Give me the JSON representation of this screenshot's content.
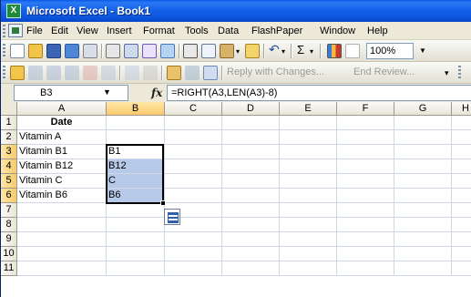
{
  "window": {
    "title": "Microsoft Excel - Book1",
    "app_icon_glyph": "X"
  },
  "menu": [
    "File",
    "Edit",
    "View",
    "Insert",
    "Format",
    "Tools",
    "Data",
    "FlashPaper",
    "Window",
    "Help"
  ],
  "toolbar": {
    "zoom": "100%",
    "sum_glyph": "Σ",
    "undo_glyph": "↶",
    "redo_glyph": "↷"
  },
  "review_toolbar": {
    "reply_label": "Reply with Changes...",
    "end_review_label": "End Review..."
  },
  "formula_bar": {
    "name_box": "B3",
    "fx_label": "fx",
    "formula": "=RIGHT(A3,LEN(A3)-8)"
  },
  "grid": {
    "columns": [
      "A",
      "B",
      "C",
      "D",
      "E",
      "F",
      "G",
      "H"
    ],
    "active_column": "B",
    "rows": [
      "1",
      "2",
      "3",
      "4",
      "5",
      "6",
      "7",
      "8",
      "9",
      "10",
      "11"
    ],
    "active_rows": [
      "3",
      "4",
      "5",
      "6"
    ],
    "cells": {
      "A1": "Date",
      "A2": "Vitamin A",
      "A3": "Vitamin B1",
      "A4": "Vitamin B12",
      "A5": "Vitamin C",
      "A6": "Vitamin B6",
      "B3": "B1",
      "B4": "B12",
      "B5": "C",
      "B6": "B6"
    },
    "selection": "B3:B6"
  },
  "colors": {
    "title_bar": "#0c55db",
    "selection_fill": "#b7c9e8",
    "active_header": "#f8c96b",
    "gridline": "#d0d7e5"
  }
}
